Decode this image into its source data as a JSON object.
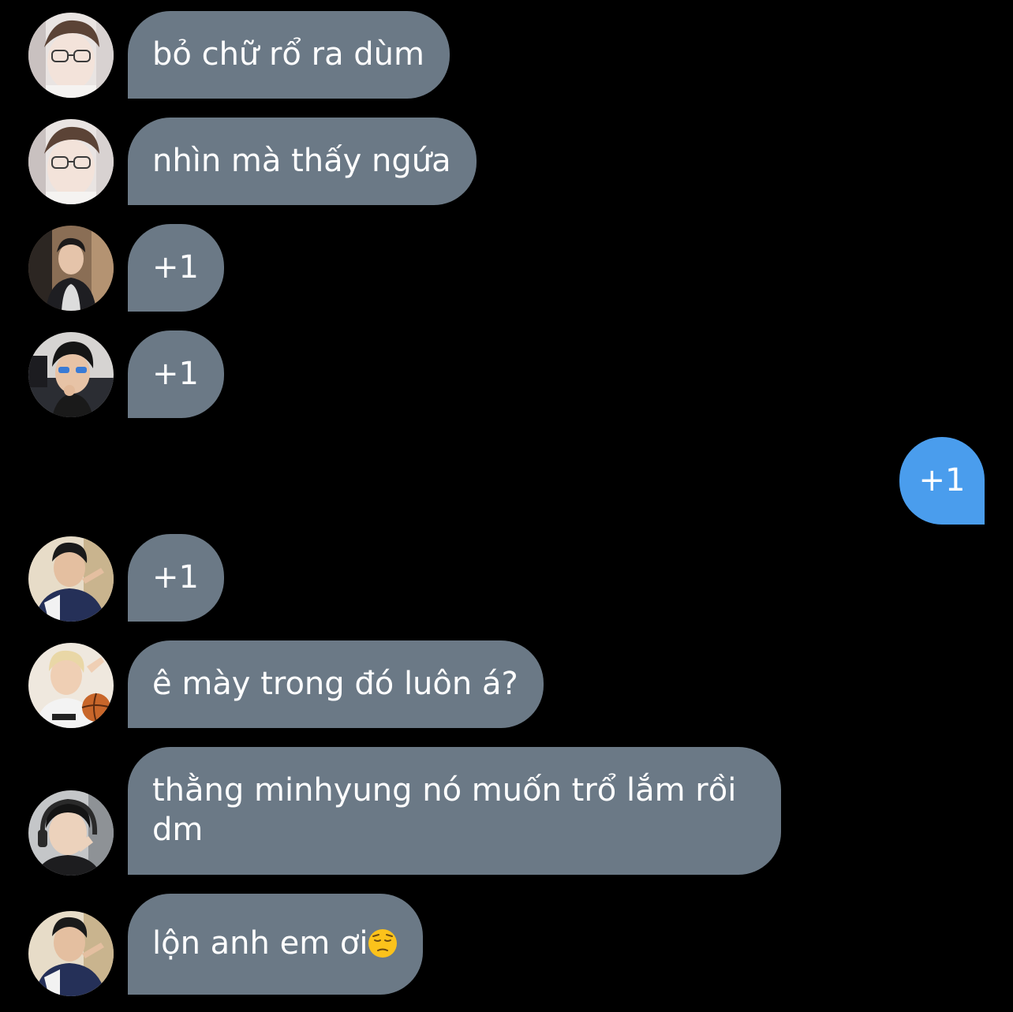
{
  "colors": {
    "background": "#000000",
    "incoming_bubble": "#6b7986",
    "outgoing_bubble": "#4a9ded",
    "text": "#ffffff"
  },
  "messages": [
    {
      "sender": "other",
      "avatar": "user-photo-glasses-light",
      "text": "bỏ chữ rổ ra dùm"
    },
    {
      "sender": "other",
      "avatar": "user-photo-glasses-light",
      "text": "nhìn mà thấy ngứa"
    },
    {
      "sender": "other",
      "avatar": "user-photo-dark-room",
      "text": "+1"
    },
    {
      "sender": "other",
      "avatar": "user-photo-headset-glasses",
      "text": "+1"
    },
    {
      "sender": "me",
      "text": "+1"
    },
    {
      "sender": "other",
      "avatar": "user-photo-peace-sign",
      "text": "+1"
    },
    {
      "sender": "other",
      "avatar": "user-photo-basketball",
      "text": "ê mày trong đó luôn á?"
    },
    {
      "sender": "other",
      "avatar": "user-photo-headphones",
      "text": "thằng minhyung nó muốn trổ lắm rồi dm"
    },
    {
      "sender": "other",
      "avatar": "user-photo-peace-sign",
      "text": "lộn anh em ơi",
      "emoji": "pensive-face-icon"
    }
  ]
}
